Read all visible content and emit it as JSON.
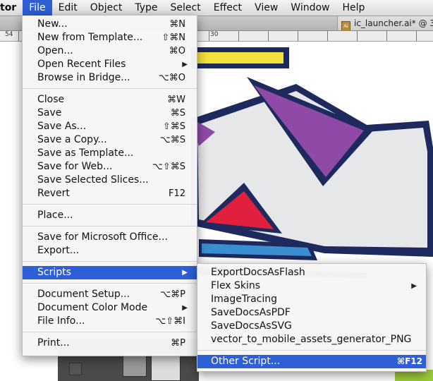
{
  "menubar": {
    "app": "tor",
    "items": [
      "File",
      "Edit",
      "Object",
      "Type",
      "Select",
      "Effect",
      "View",
      "Window",
      "Help"
    ],
    "active": "File"
  },
  "document_tab": {
    "title": "ic_launcher.ai* @ 3"
  },
  "ruler": {
    "labels": [
      "54",
      "30"
    ]
  },
  "file_menu": {
    "items": [
      {
        "label": "New...",
        "shortcut": "⌘N"
      },
      {
        "label": "New from Template...",
        "shortcut": "⇧⌘N"
      },
      {
        "label": "Open...",
        "shortcut": "⌘O"
      },
      {
        "label": "Open Recent Files",
        "submenu": true
      },
      {
        "label": "Browse in Bridge...",
        "shortcut": "⌥⌘O"
      },
      {
        "label": "Close",
        "shortcut": "⌘W"
      },
      {
        "label": "Save",
        "shortcut": "⌘S"
      },
      {
        "label": "Save As...",
        "shortcut": "⇧⌘S"
      },
      {
        "label": "Save a Copy...",
        "shortcut": "⌥⌘S"
      },
      {
        "label": "Save as Template..."
      },
      {
        "label": "Save for Web...",
        "shortcut": "⌥⇧⌘S"
      },
      {
        "label": "Save Selected Slices..."
      },
      {
        "label": "Revert",
        "shortcut": "F12"
      },
      {
        "label": "Place..."
      },
      {
        "label": "Save for Microsoft Office..."
      },
      {
        "label": "Export..."
      },
      {
        "label": "Scripts",
        "submenu": true,
        "highlighted": true
      },
      {
        "label": "Document Setup...",
        "shortcut": "⌥⌘P"
      },
      {
        "label": "Document Color Mode",
        "submenu": true
      },
      {
        "label": "File Info...",
        "shortcut": "⌥⇧⌘I"
      },
      {
        "label": "Print...",
        "shortcut": "⌘P"
      }
    ]
  },
  "scripts_menu": {
    "items": [
      {
        "label": "ExportDocsAsFlash"
      },
      {
        "label": "Flex Skins",
        "submenu": true
      },
      {
        "label": "ImageTracing"
      },
      {
        "label": "SaveDocsAsPDF"
      },
      {
        "label": "SaveDocsAsSVG"
      },
      {
        "label": "vector_to_mobile_assets_generator_PNG"
      },
      {
        "label": "Other Script...",
        "shortcut": "⌘F12",
        "highlighted": true
      }
    ]
  },
  "colors": {
    "highlight": "#2e5fd6",
    "navy": "#1e2a5e",
    "purple": "#8e4aa6",
    "yellow": "#f3e23b",
    "red": "#e0203c",
    "blue": "#3a8fd0",
    "light_gray": "#e6e7e8"
  }
}
